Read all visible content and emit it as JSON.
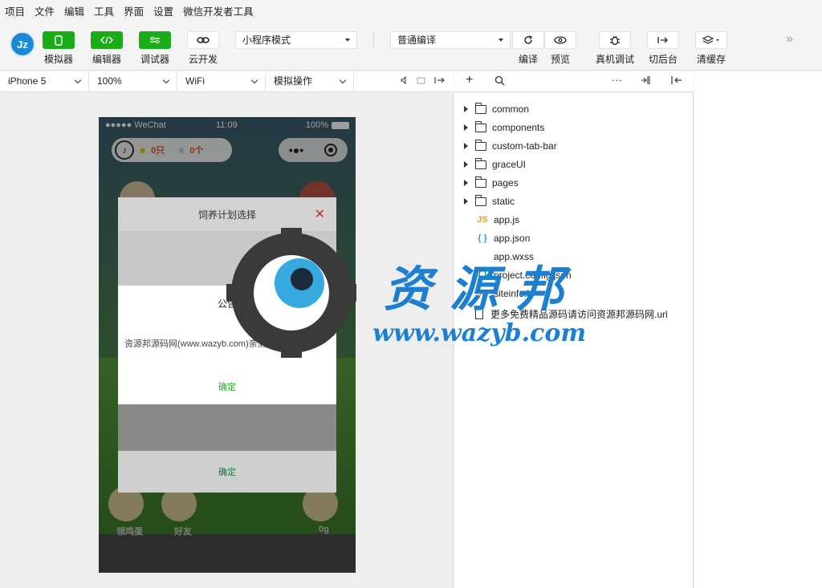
{
  "menu": [
    "项目",
    "文件",
    "编辑",
    "工具",
    "界面",
    "设置",
    "微信开发者工具"
  ],
  "toolbar": {
    "avatar_text": "Jz",
    "simulator": "模拟器",
    "editor": "编辑器",
    "debugger": "调试器",
    "cloud": "云开发",
    "mode_select": "小程序模式",
    "compile_select": "普通编译",
    "compile": "编译",
    "preview": "预览",
    "remote_debug": "真机调试",
    "background": "切后台",
    "clear_cache": "清缓存",
    "more": "»"
  },
  "devicebar": {
    "device": "iPhone 5",
    "zoom": "100%",
    "network": "WiFi",
    "operation": "模拟操作"
  },
  "phone": {
    "status_left": "●●●●● WeChat",
    "status_time": "11:09",
    "status_battery": "100%",
    "chick_count": "0只",
    "egg_count": "0个",
    "menu_dots": "•●•",
    "bottom_labels": [
      "领鸡蛋",
      "好友",
      "0g"
    ]
  },
  "plan_dialog": {
    "title": "饲养计划选择",
    "close": "✕",
    "confirm": "确定"
  },
  "notice": {
    "title": "公告",
    "body": "资源邦源码网(www.wazyb.com)亲测",
    "confirm": "确定"
  },
  "explorer": {
    "folders": [
      "common",
      "components",
      "custom-tab-bar",
      "graceUI",
      "pages",
      "static"
    ],
    "files": [
      {
        "icon": "JS",
        "name": "app.js",
        "color": "#f0a020"
      },
      {
        "icon": "{ }",
        "name": "app.json",
        "color": "#3a8ee6"
      },
      {
        "icon": "",
        "name": "app.wxss",
        "color": "#3a8ee6"
      },
      {
        "icon": "{ }",
        "name": "project.config.json",
        "color": "#1aad19"
      },
      {
        "icon": "JS",
        "name": "siteinfo.js",
        "color": "#f0a020"
      }
    ],
    "doc_file": "更多免费精品源码请访问资源邦源码网.url"
  },
  "watermark": {
    "chinese": "资源邦",
    "url": "www.wazyb.com"
  }
}
